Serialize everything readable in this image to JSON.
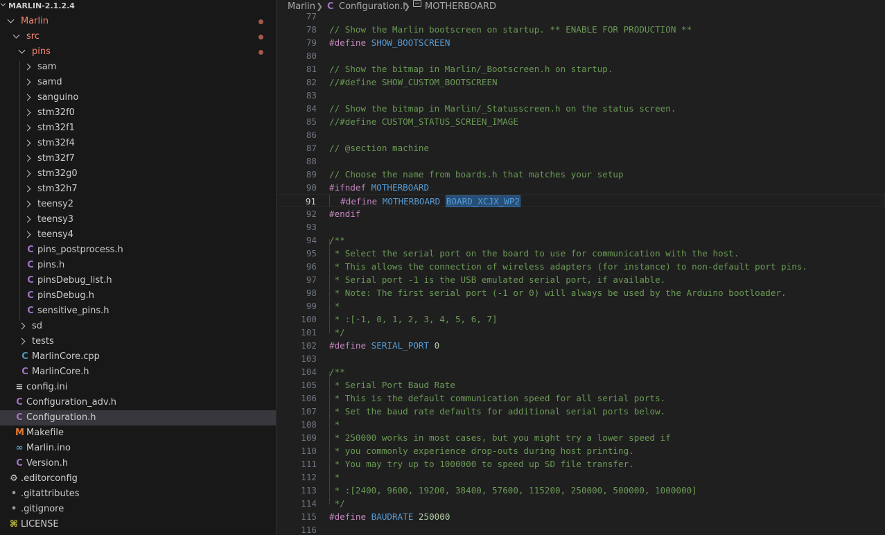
{
  "explorer": {
    "title": "MARLIN-2.1.2.4",
    "items": [
      {
        "label": "Marlin",
        "kind": "folder-open",
        "depth": 0,
        "git": true,
        "modified": true
      },
      {
        "label": "src",
        "kind": "folder-open",
        "depth": 1,
        "git": true,
        "modified": true
      },
      {
        "label": "pins",
        "kind": "folder-open",
        "depth": 2,
        "git": true,
        "modified": true
      },
      {
        "label": "sam",
        "kind": "folder",
        "depth": 3
      },
      {
        "label": "samd",
        "kind": "folder",
        "depth": 3
      },
      {
        "label": "sanguino",
        "kind": "folder",
        "depth": 3
      },
      {
        "label": "stm32f0",
        "kind": "folder",
        "depth": 3
      },
      {
        "label": "stm32f1",
        "kind": "folder",
        "depth": 3
      },
      {
        "label": "stm32f4",
        "kind": "folder",
        "depth": 3
      },
      {
        "label": "stm32f7",
        "kind": "folder",
        "depth": 3
      },
      {
        "label": "stm32g0",
        "kind": "folder",
        "depth": 3
      },
      {
        "label": "stm32h7",
        "kind": "folder",
        "depth": 3
      },
      {
        "label": "teensy2",
        "kind": "folder",
        "depth": 3
      },
      {
        "label": "teensy3",
        "kind": "folder",
        "depth": 3
      },
      {
        "label": "teensy4",
        "kind": "folder",
        "depth": 3
      },
      {
        "label": "pins_postprocess.h",
        "kind": "c",
        "depth": 3
      },
      {
        "label": "pins.h",
        "kind": "c",
        "depth": 3
      },
      {
        "label": "pinsDebug_list.h",
        "kind": "c",
        "depth": 3
      },
      {
        "label": "pinsDebug.h",
        "kind": "c",
        "depth": 3
      },
      {
        "label": "sensitive_pins.h",
        "kind": "c",
        "depth": 3
      },
      {
        "label": "sd",
        "kind": "folder",
        "depth": 2
      },
      {
        "label": "tests",
        "kind": "folder",
        "depth": 2
      },
      {
        "label": "MarlinCore.cpp",
        "kind": "cpp",
        "depth": 2
      },
      {
        "label": "MarlinCore.h",
        "kind": "c",
        "depth": 2
      },
      {
        "label": "config.ini",
        "kind": "lines",
        "depth": 1
      },
      {
        "label": "Configuration_adv.h",
        "kind": "c",
        "depth": 1
      },
      {
        "label": "Configuration.h",
        "kind": "c",
        "depth": 1,
        "selected": true
      },
      {
        "label": "Makefile",
        "kind": "m",
        "depth": 1
      },
      {
        "label": "Marlin.ino",
        "kind": "ino",
        "depth": 1
      },
      {
        "label": "Version.h",
        "kind": "c",
        "depth": 1
      },
      {
        "label": ".editorconfig",
        "kind": "gear",
        "depth": 0
      },
      {
        "label": ".gitattributes",
        "kind": "dot",
        "depth": 0
      },
      {
        "label": ".gitignore",
        "kind": "dot",
        "depth": 0
      },
      {
        "label": "LICENSE",
        "kind": "license",
        "depth": 0
      }
    ]
  },
  "breadcrumb": {
    "folder": "Marlin",
    "file_icon": "C",
    "file": "Configuration.h",
    "symbol": "MOTHERBOARD"
  },
  "editor": {
    "active_line": 91,
    "lines": [
      {
        "n": "77",
        "parts": []
      },
      {
        "n": "78",
        "parts": [
          [
            "c-com",
            "// Show the Marlin bootscreen on startup. ** ENABLE FOR PRODUCTION **"
          ]
        ]
      },
      {
        "n": "79",
        "parts": [
          [
            "c-dir",
            "#define "
          ],
          [
            "c-mac",
            "SHOW_BOOTSCREEN"
          ]
        ]
      },
      {
        "n": "80",
        "parts": []
      },
      {
        "n": "81",
        "parts": [
          [
            "c-com",
            "// Show the bitmap in Marlin/_Bootscreen.h on startup."
          ]
        ]
      },
      {
        "n": "82",
        "parts": [
          [
            "c-com",
            "//#define SHOW_CUSTOM_BOOTSCREEN"
          ]
        ]
      },
      {
        "n": "83",
        "parts": []
      },
      {
        "n": "84",
        "parts": [
          [
            "c-com",
            "// Show the bitmap in Marlin/_Statusscreen.h on the status screen."
          ]
        ]
      },
      {
        "n": "85",
        "parts": [
          [
            "c-com",
            "//#define CUSTOM_STATUS_SCREEN_IMAGE"
          ]
        ]
      },
      {
        "n": "86",
        "parts": []
      },
      {
        "n": "87",
        "parts": [
          [
            "c-com",
            "// @section machine"
          ]
        ]
      },
      {
        "n": "88",
        "parts": []
      },
      {
        "n": "89",
        "parts": [
          [
            "c-com",
            "// Choose the name from boards.h that matches your setup"
          ]
        ]
      },
      {
        "n": "90",
        "parts": [
          [
            "c-dir",
            "#ifndef "
          ],
          [
            "c-mac",
            "MOTHERBOARD"
          ]
        ]
      },
      {
        "n": "91",
        "parts": [
          [
            "c-pl",
            "  "
          ],
          [
            "c-dir",
            "#define "
          ],
          [
            "c-mac",
            "MOTHERBOARD "
          ],
          [
            "c-mac c-hl",
            "BOARD_XCJX_WP2"
          ]
        ]
      },
      {
        "n": "92",
        "parts": [
          [
            "c-dir",
            "#endif"
          ]
        ]
      },
      {
        "n": "93",
        "parts": []
      },
      {
        "n": "94",
        "parts": [
          [
            "c-com",
            "/**"
          ]
        ]
      },
      {
        "n": "95",
        "parts": [
          [
            "c-com",
            " * Select the serial port on the board to use for communication with the host."
          ]
        ]
      },
      {
        "n": "96",
        "parts": [
          [
            "c-com",
            " * This allows the connection of wireless adapters (for instance) to non-default port pins."
          ]
        ]
      },
      {
        "n": "97",
        "parts": [
          [
            "c-com",
            " * Serial port -1 is the USB emulated serial port, if available."
          ]
        ]
      },
      {
        "n": "98",
        "parts": [
          [
            "c-com",
            " * Note: The first serial port (-1 or 0) will always be used by the Arduino bootloader."
          ]
        ]
      },
      {
        "n": "99",
        "parts": [
          [
            "c-com",
            " *"
          ]
        ]
      },
      {
        "n": "100",
        "parts": [
          [
            "c-com",
            " * :[-1, 0, 1, 2, 3, 4, 5, 6, 7]"
          ]
        ]
      },
      {
        "n": "101",
        "parts": [
          [
            "c-com",
            " */"
          ]
        ]
      },
      {
        "n": "102",
        "parts": [
          [
            "c-dir",
            "#define "
          ],
          [
            "c-mac",
            "SERIAL_PORT "
          ],
          [
            "c-num",
            "0"
          ]
        ]
      },
      {
        "n": "103",
        "parts": []
      },
      {
        "n": "104",
        "parts": [
          [
            "c-com",
            "/**"
          ]
        ]
      },
      {
        "n": "105",
        "parts": [
          [
            "c-com",
            " * Serial Port Baud Rate"
          ]
        ]
      },
      {
        "n": "106",
        "parts": [
          [
            "c-com",
            " * This is the default communication speed for all serial ports."
          ]
        ]
      },
      {
        "n": "107",
        "parts": [
          [
            "c-com",
            " * Set the baud rate defaults for additional serial ports below."
          ]
        ]
      },
      {
        "n": "108",
        "parts": [
          [
            "c-com",
            " *"
          ]
        ]
      },
      {
        "n": "109",
        "parts": [
          [
            "c-com",
            " * 250000 works in most cases, but you might try a lower speed if"
          ]
        ]
      },
      {
        "n": "110",
        "parts": [
          [
            "c-com",
            " * you commonly experience drop-outs during host printing."
          ]
        ]
      },
      {
        "n": "111",
        "parts": [
          [
            "c-com",
            " * You may try up to 1000000 to speed up SD file transfer."
          ]
        ]
      },
      {
        "n": "112",
        "parts": [
          [
            "c-com",
            " *"
          ]
        ]
      },
      {
        "n": "113",
        "parts": [
          [
            "c-com",
            " * :[2400, 9600, 19200, 38400, 57600, 115200, 250000, 500000, 1000000]"
          ]
        ]
      },
      {
        "n": "114",
        "parts": [
          [
            "c-com",
            " */"
          ]
        ]
      },
      {
        "n": "115",
        "parts": [
          [
            "c-dir",
            "#define "
          ],
          [
            "c-mac",
            "BAUDRATE "
          ],
          [
            "c-num",
            "250000"
          ]
        ]
      },
      {
        "n": "116",
        "parts": []
      }
    ]
  }
}
